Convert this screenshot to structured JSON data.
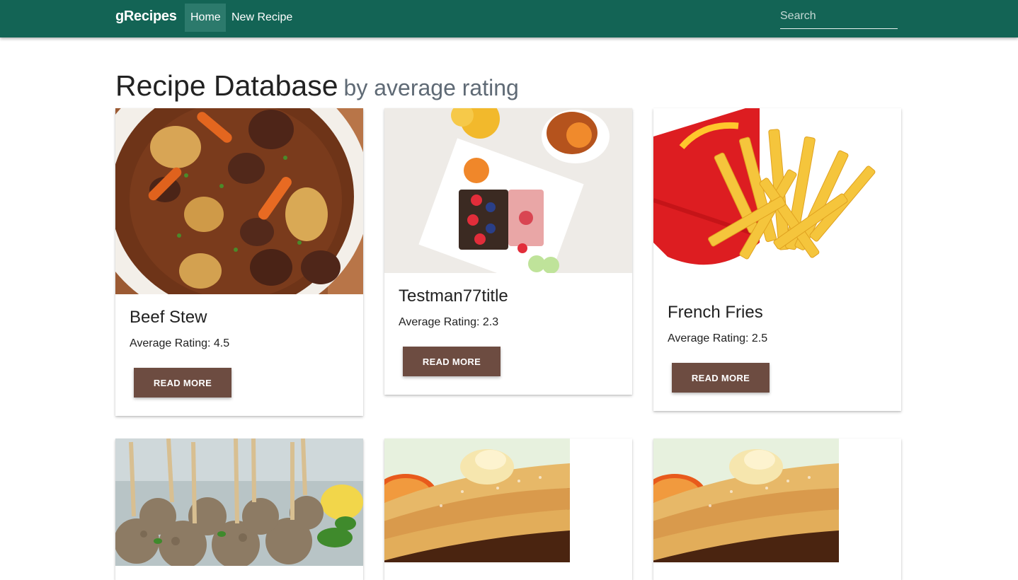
{
  "navbar": {
    "brand": "gRecipes",
    "links": [
      {
        "label": "Home",
        "active": true
      },
      {
        "label": "New Recipe",
        "active": false
      }
    ],
    "search_placeholder": "Search",
    "bg_color": "#136455"
  },
  "page": {
    "title": "Recipe Database",
    "subtitle": "by average rating"
  },
  "rating_prefix": "Average Rating: ",
  "button_color": "#6d4c41",
  "recipes": [
    {
      "title": "Beef Stew",
      "rating": "4.5",
      "button": "READ MORE",
      "image": "beef-stew-photo"
    },
    {
      "title": "Testman77title",
      "rating": "2.3",
      "button": "READ MORE",
      "image": "breakfast-plate-photo"
    },
    {
      "title": "French Fries",
      "rating": "2.5",
      "button": "READ MORE",
      "image": "french-fries-photo"
    },
    {
      "title": "",
      "rating": "",
      "button": "",
      "image": "meatballs-photo"
    },
    {
      "title": "",
      "rating": "",
      "button": "",
      "image": "pancakes-photo"
    },
    {
      "title": "",
      "rating": "",
      "button": "",
      "image": "pancakes-photo"
    }
  ]
}
